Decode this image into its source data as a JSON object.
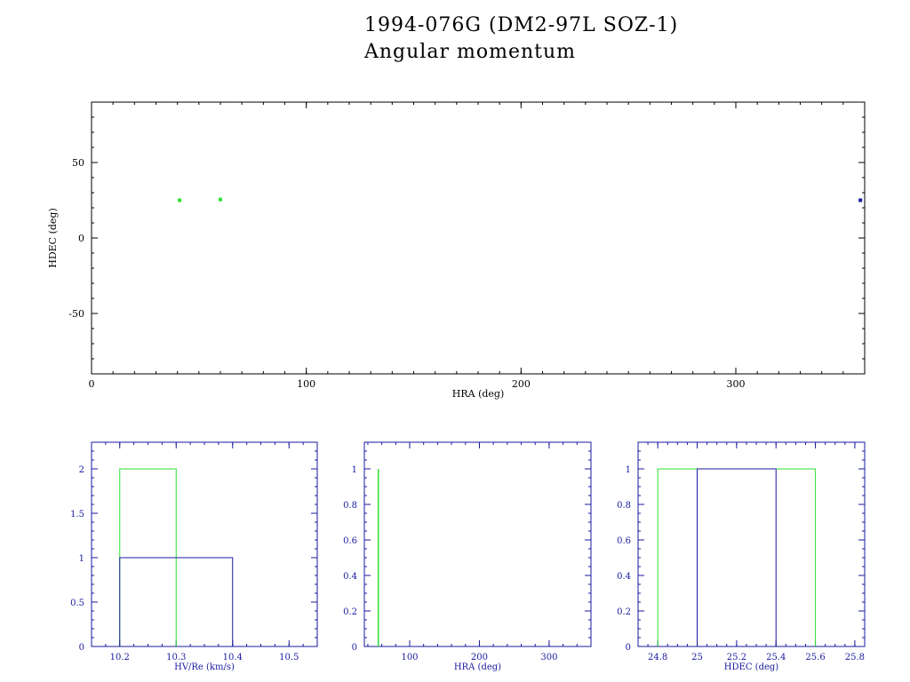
{
  "title": "1994-076G (DM2-97L SOZ-1)",
  "subtitle": "Angular momentum",
  "colors": {
    "green": "#2ee02e",
    "blue": "#1a1aa0",
    "axis_top": "#000000",
    "axis_bottom": "#1a1aa0"
  },
  "chart_data": [
    {
      "type": "scatter",
      "xlabel": "HRA (deg)",
      "ylabel": "HDEC (deg)",
      "xlim": [
        0,
        360
      ],
      "ylim": [
        -90,
        90
      ],
      "xticks": [
        0,
        100,
        200,
        300
      ],
      "yticks": [
        50,
        0,
        -50
      ],
      "series": [
        {
          "color": "green",
          "points": [
            [
              41,
              25
            ],
            [
              60,
              25.5
            ]
          ]
        },
        {
          "color": "blue",
          "points": [
            [
              358,
              25
            ]
          ]
        }
      ]
    },
    {
      "type": "histogram",
      "xlabel": "HV/Re (km/s)",
      "xlim": [
        10.15,
        10.55
      ],
      "ylim": [
        0,
        2.3
      ],
      "xticks": [
        10.2,
        10.3,
        10.4,
        10.5
      ],
      "xtick_labels": [
        "10.2",
        "10.3",
        "10.4",
        "10.5"
      ],
      "yticks": [
        0,
        0.5,
        1,
        1.5,
        2
      ],
      "ytick_labels": [
        "0",
        "0.5",
        "1",
        "1.5",
        "2"
      ],
      "series": [
        {
          "color": "green",
          "bins": [
            [
              10.2,
              10.3,
              2
            ]
          ]
        },
        {
          "color": "blue",
          "bins": [
            [
              10.2,
              10.4,
              1
            ]
          ]
        }
      ]
    },
    {
      "type": "histogram",
      "xlabel": "HRA (deg)",
      "xlim": [
        35,
        360
      ],
      "ylim": [
        0,
        1.15
      ],
      "xticks": [
        100,
        200,
        300
      ],
      "xtick_labels": [
        "100",
        "200",
        "300"
      ],
      "yticks": [
        0,
        0.2,
        0.4,
        0.6,
        0.8,
        1
      ],
      "ytick_labels": [
        "0",
        "0.2",
        "0.4",
        "0.6",
        "0.8",
        "1"
      ],
      "series": [
        {
          "color": "green",
          "bins": [
            [
              55,
              55,
              1
            ]
          ]
        }
      ]
    },
    {
      "type": "histogram",
      "xlabel": "HDEC (deg)",
      "xlim": [
        24.7,
        25.85
      ],
      "ylim": [
        0,
        1.15
      ],
      "xticks": [
        24.8,
        25,
        25.2,
        25.4,
        25.6,
        25.8
      ],
      "xtick_labels": [
        "24.8",
        "25",
        "25.2",
        "25.4",
        "25.6",
        "25.8"
      ],
      "yticks": [
        0,
        0.2,
        0.4,
        0.6,
        0.8,
        1
      ],
      "ytick_labels": [
        "0",
        "0.2",
        "0.4",
        "0.6",
        "0.8",
        "1"
      ],
      "series": [
        {
          "color": "green",
          "bins": [
            [
              24.8,
              25.6,
              1
            ]
          ]
        },
        {
          "color": "blue",
          "bins": [
            [
              25.0,
              25.4,
              1
            ]
          ]
        }
      ]
    }
  ]
}
